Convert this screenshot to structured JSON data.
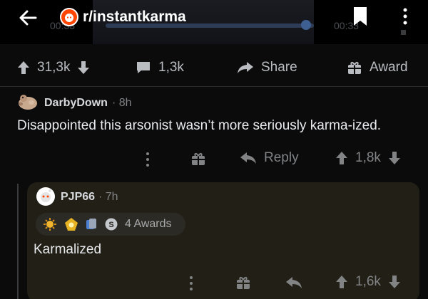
{
  "header": {
    "subreddit": "r/instantkarma",
    "time_left": "00:33",
    "time_right": "00:33",
    "icons": [
      "back-arrow-icon",
      "reddit-logo-icon",
      "bookmark-icon",
      "more-vertical-icon"
    ]
  },
  "post_actions": {
    "upvotes": "31,3k",
    "comments": "1,3k",
    "share_label": "Share",
    "award_label": "Award"
  },
  "comment1": {
    "username": "DarbyDown",
    "time": "8h",
    "body": "Disappointed this arsonist wasn’t more seriously karma-ized.",
    "reply_label": "Reply",
    "votes": "1,8k"
  },
  "comment2": {
    "username": "PJP66",
    "time": "7h",
    "awards_text": "4 Awards",
    "body": "Karmalized",
    "votes": "1,6k"
  },
  "colors": {
    "background": "#0b0b0c",
    "reply_card": "#221f16",
    "accent": "#ff4500"
  }
}
